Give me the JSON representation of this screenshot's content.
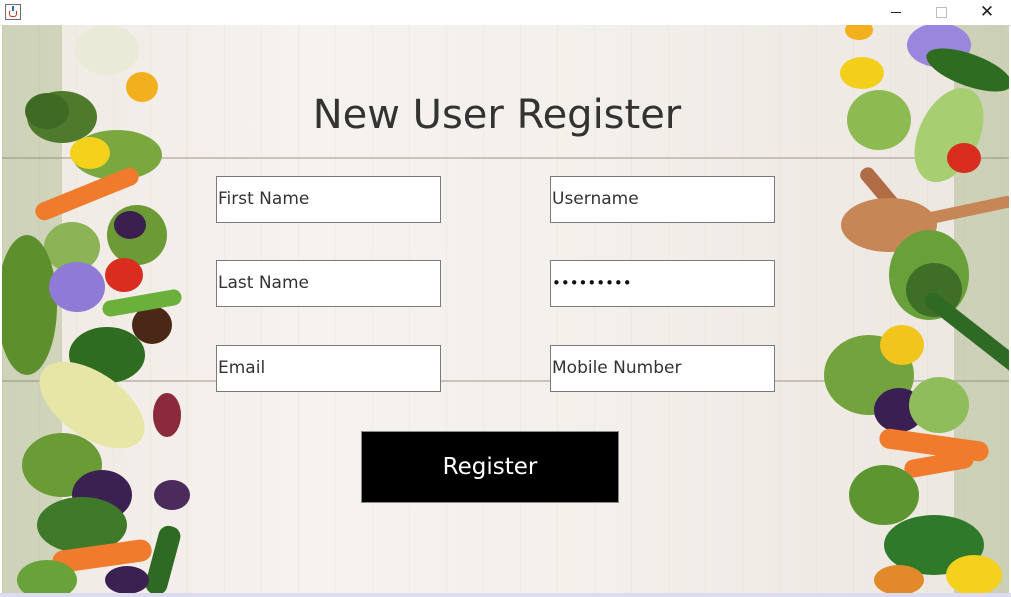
{
  "window": {
    "minimize_symbol": "",
    "close_symbol": "✕"
  },
  "form": {
    "title": "New User Register",
    "first_name": "First Name",
    "last_name": "Last Name",
    "email": "Email",
    "username": "Username",
    "password_masked": "•••••••••",
    "mobile": "Mobile Number",
    "register_label": "Register"
  },
  "colors": {
    "button_bg": "#000000",
    "button_text": "#ffffff",
    "title_text": "#333333",
    "background": "#f3efea"
  },
  "icons": [
    "java-app-icon",
    "minimize-icon",
    "maximize-icon",
    "close-icon"
  ]
}
